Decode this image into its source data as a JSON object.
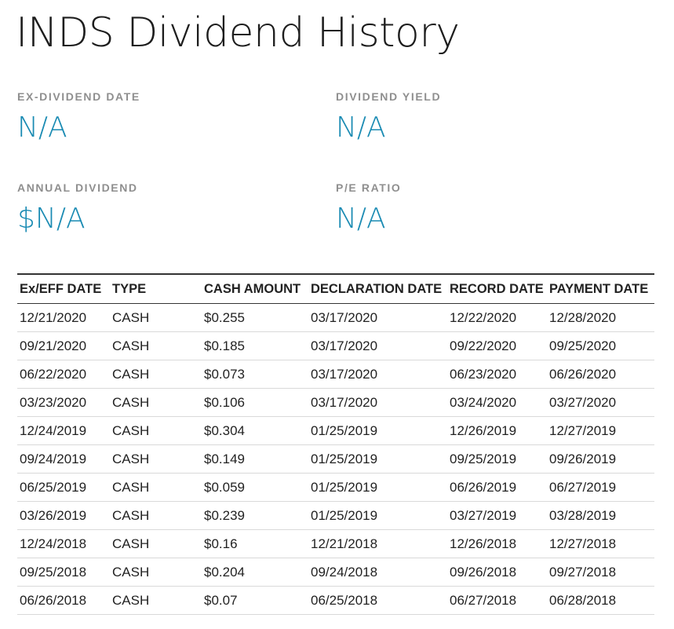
{
  "page": {
    "title": "INDS Dividend History"
  },
  "stats": {
    "ex_dividend_date": {
      "label": "EX-DIVIDEND DATE",
      "value": "N/A"
    },
    "dividend_yield": {
      "label": "DIVIDEND YIELD",
      "value": "N/A"
    },
    "annual_dividend": {
      "label": "ANNUAL DIVIDEND",
      "value": "$N/A"
    },
    "pe_ratio": {
      "label": "P/E RATIO",
      "value": "N/A"
    }
  },
  "colors": {
    "accent": "#1a8bb3",
    "label_gray": "#8f8f8f",
    "text": "#222222"
  },
  "table": {
    "headers": [
      "Ex/EFF DATE",
      "TYPE",
      "CASH AMOUNT",
      "DECLARATION DATE",
      "RECORD DATE",
      "PAYMENT DATE"
    ],
    "rows": [
      [
        "12/21/2020",
        "CASH",
        "$0.255",
        "03/17/2020",
        "12/22/2020",
        "12/28/2020"
      ],
      [
        "09/21/2020",
        "CASH",
        "$0.185",
        "03/17/2020",
        "09/22/2020",
        "09/25/2020"
      ],
      [
        "06/22/2020",
        "CASH",
        "$0.073",
        "03/17/2020",
        "06/23/2020",
        "06/26/2020"
      ],
      [
        "03/23/2020",
        "CASH",
        "$0.106",
        "03/17/2020",
        "03/24/2020",
        "03/27/2020"
      ],
      [
        "12/24/2019",
        "CASH",
        "$0.304",
        "01/25/2019",
        "12/26/2019",
        "12/27/2019"
      ],
      [
        "09/24/2019",
        "CASH",
        "$0.149",
        "01/25/2019",
        "09/25/2019",
        "09/26/2019"
      ],
      [
        "06/25/2019",
        "CASH",
        "$0.059",
        "01/25/2019",
        "06/26/2019",
        "06/27/2019"
      ],
      [
        "03/26/2019",
        "CASH",
        "$0.239",
        "01/25/2019",
        "03/27/2019",
        "03/28/2019"
      ],
      [
        "12/24/2018",
        "CASH",
        "$0.16",
        "12/21/2018",
        "12/26/2018",
        "12/27/2018"
      ],
      [
        "09/25/2018",
        "CASH",
        "$0.204",
        "09/24/2018",
        "09/26/2018",
        "09/27/2018"
      ],
      [
        "06/26/2018",
        "CASH",
        "$0.07",
        "06/25/2018",
        "06/27/2018",
        "06/28/2018"
      ]
    ]
  }
}
